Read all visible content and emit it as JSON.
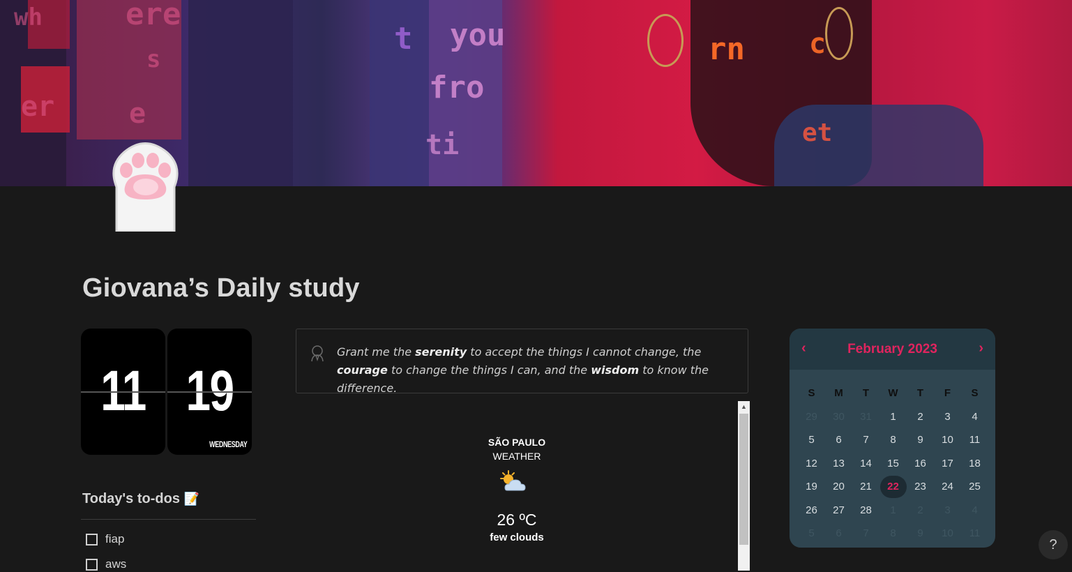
{
  "page": {
    "title": "Giovana’s Daily study",
    "icon": "paw-icon"
  },
  "clock": {
    "hours": "11",
    "minutes": "19",
    "day": "WEDNESDAY"
  },
  "quote": {
    "parts": [
      "Grant me the ",
      "serenity",
      " to accept the things I cannot change, the ",
      "courage",
      " to change the things I can, and the ",
      "wisdom",
      " to know the difference."
    ]
  },
  "todos": {
    "heading": "Today's to-dos",
    "heading_emoji": "📝",
    "items": [
      {
        "label": "fiap",
        "checked": false
      },
      {
        "label": "aws",
        "checked": false
      }
    ]
  },
  "weather": {
    "city": "SÃO PAULO",
    "label": "WEATHER",
    "icon": "partly-cloudy-icon",
    "temperature": "26 ºC",
    "description": "few clouds"
  },
  "calendar": {
    "month": "February 2023",
    "accent": "#e0245e",
    "weekdays": [
      "S",
      "M",
      "T",
      "W",
      "T",
      "F",
      "S"
    ],
    "weeks": [
      [
        {
          "d": "29",
          "m": 1
        },
        {
          "d": "30",
          "m": 1
        },
        {
          "d": "31",
          "m": 1
        },
        {
          "d": "1"
        },
        {
          "d": "2"
        },
        {
          "d": "3"
        },
        {
          "d": "4"
        }
      ],
      [
        {
          "d": "5"
        },
        {
          "d": "6"
        },
        {
          "d": "7"
        },
        {
          "d": "8"
        },
        {
          "d": "9"
        },
        {
          "d": "10"
        },
        {
          "d": "11"
        }
      ],
      [
        {
          "d": "12"
        },
        {
          "d": "13"
        },
        {
          "d": "14"
        },
        {
          "d": "15"
        },
        {
          "d": "16"
        },
        {
          "d": "17"
        },
        {
          "d": "18"
        }
      ],
      [
        {
          "d": "19"
        },
        {
          "d": "20"
        },
        {
          "d": "21"
        },
        {
          "d": "22",
          "t": 1
        },
        {
          "d": "23"
        },
        {
          "d": "24"
        },
        {
          "d": "25"
        }
      ],
      [
        {
          "d": "26"
        },
        {
          "d": "27"
        },
        {
          "d": "28"
        },
        {
          "d": "1",
          "m": 1
        },
        {
          "d": "2",
          "m": 1
        },
        {
          "d": "3",
          "m": 1
        },
        {
          "d": "4",
          "m": 1
        }
      ],
      [
        {
          "d": "5",
          "m": 1
        },
        {
          "d": "6",
          "m": 1
        },
        {
          "d": "7",
          "m": 1
        },
        {
          "d": "8",
          "m": 1
        },
        {
          "d": "9",
          "m": 1
        },
        {
          "d": "10",
          "m": 1
        },
        {
          "d": "11",
          "m": 1
        }
      ]
    ]
  },
  "help": {
    "label": "?"
  }
}
